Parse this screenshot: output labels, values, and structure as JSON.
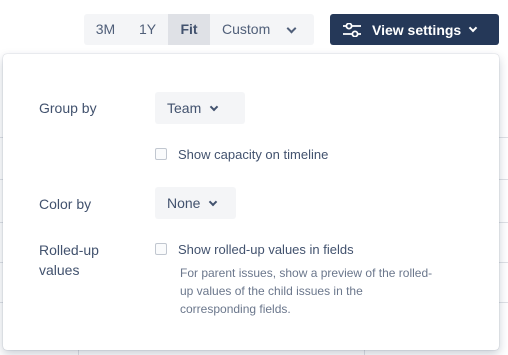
{
  "toolbar": {
    "ranges": [
      "3M",
      "1Y",
      "Fit",
      "Custom"
    ],
    "selected_range": "Fit",
    "view_settings_label": "View settings"
  },
  "panel": {
    "group_by": {
      "label": "Group by",
      "value": "Team"
    },
    "show_capacity": {
      "label": "Show capacity on timeline",
      "checked": false
    },
    "color_by": {
      "label": "Color by",
      "value": "None"
    },
    "rolled_up": {
      "label_line1": "Rolled-up",
      "label_line2": "values",
      "checkbox_label": "Show rolled-up values in fields",
      "checked": false,
      "help_line1": "For parent issues, show a preview of the rolled-",
      "help_line2": "up values of the child issues in the",
      "help_line3": "corresponding fields."
    }
  },
  "colors": {
    "primary_button": "#253858",
    "selected_segment": "#dfe1e6",
    "field_background": "#f4f5f7"
  }
}
